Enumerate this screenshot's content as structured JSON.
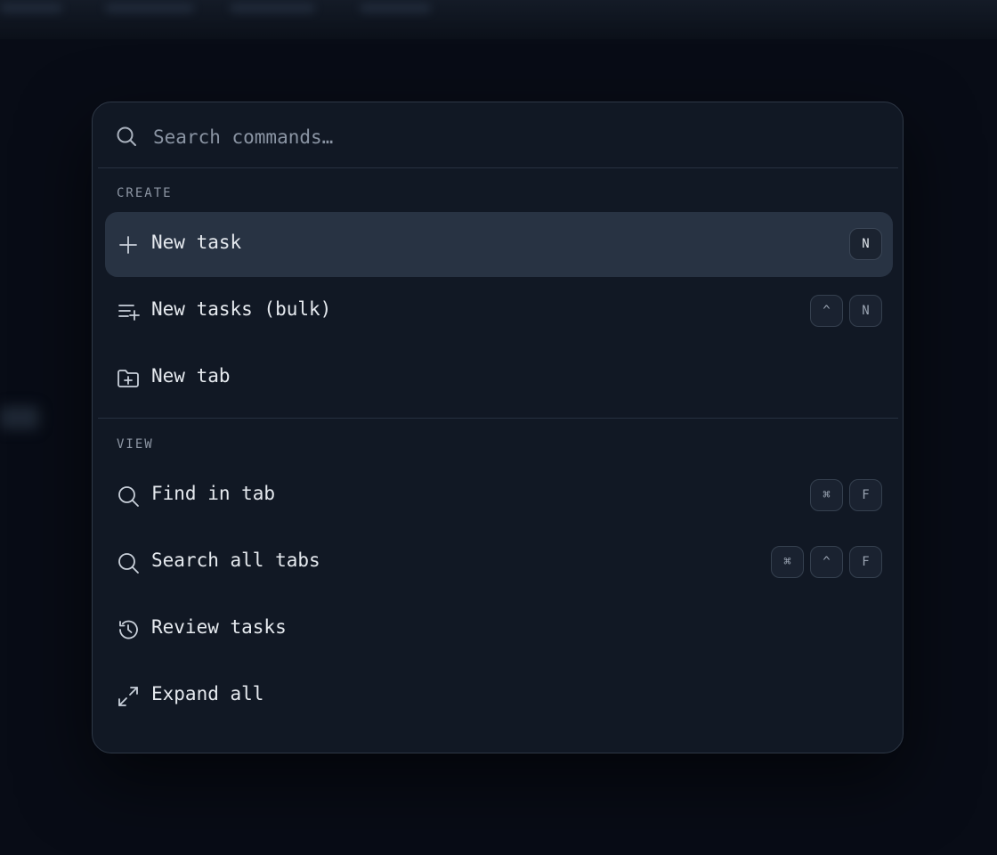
{
  "search": {
    "placeholder": "Search commands…",
    "value": ""
  },
  "sections": [
    {
      "label": "CREATE",
      "items": [
        {
          "label": "New task",
          "icon": "plus-icon",
          "keys": [
            "N"
          ],
          "active": true
        },
        {
          "label": "New tasks (bulk)",
          "icon": "list-plus-icon",
          "keys": [
            "^",
            "N"
          ]
        },
        {
          "label": "New tab",
          "icon": "folder-plus-icon",
          "keys": []
        }
      ]
    },
    {
      "label": "VIEW",
      "items": [
        {
          "label": "Find in tab",
          "icon": "search-icon",
          "keys": [
            "⌘",
            "F"
          ]
        },
        {
          "label": "Search all tabs",
          "icon": "search-icon",
          "keys": [
            "⌘",
            "^",
            "F"
          ]
        },
        {
          "label": "Review tasks",
          "icon": "history-icon",
          "keys": []
        },
        {
          "label": "Expand all",
          "icon": "expand-icon",
          "keys": []
        }
      ]
    }
  ]
}
